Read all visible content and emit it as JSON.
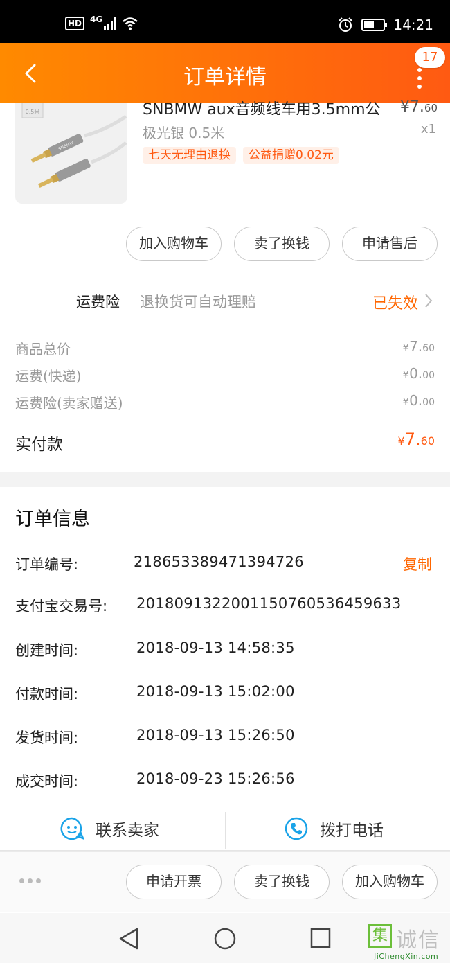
{
  "status_bar": {
    "hd": "HD",
    "network": "4G",
    "time": "14:21",
    "battery_level": 0.55
  },
  "nav": {
    "title": "订单详情",
    "badge_count": "17"
  },
  "product": {
    "name": "SNBMW aux音频线车用3.5mm公",
    "price_symbol": "¥",
    "price_int": "7.",
    "price_dec": "60",
    "spec": "极光银 0.5米",
    "qty": "x1",
    "image_label": "0.5米",
    "image_brand": "SNBMW",
    "tags": [
      "七天无理由退换",
      "公益捐赠0.02元"
    ]
  },
  "item_actions": [
    "加入购物车",
    "卖了换钱",
    "申请售后"
  ],
  "insurance": {
    "label": "运费险",
    "desc": "退换货可自动理赔",
    "status": "已失效"
  },
  "fees": [
    {
      "label": "商品总价",
      "symbol": "¥",
      "int": "7.",
      "dec": "60"
    },
    {
      "label": "运费(快递)",
      "symbol": "¥",
      "int": "0.",
      "dec": "00"
    },
    {
      "label": "运费险(卖家赠送)",
      "symbol": "¥",
      "int": "0.",
      "dec": "00"
    }
  ],
  "total": {
    "label": "实付款",
    "symbol": "¥",
    "int": "7.",
    "dec": "60"
  },
  "order_info": {
    "title": "订单信息",
    "copy_label": "复制",
    "rows": [
      {
        "label": "订单编号:",
        "value": "218653389471394726"
      },
      {
        "label": "支付宝交易号:",
        "value": "2018091322001150760536459633"
      },
      {
        "label": "创建时间:",
        "value": "2018-09-13 14:58:35"
      },
      {
        "label": "付款时间:",
        "value": "2018-09-13 15:02:00"
      },
      {
        "label": "发货时间:",
        "value": "2018-09-13 15:26:50"
      },
      {
        "label": "成交时间:",
        "value": "2018-09-23 15:26:56"
      }
    ]
  },
  "contact": {
    "seller": "联系卖家",
    "phone": "拨打电话"
  },
  "bottom_actions": [
    "申请开票",
    "卖了换钱",
    "加入购物车"
  ],
  "watermark": {
    "box": "集",
    "cn": "诚信",
    "en": "JiChengXin.com"
  },
  "colors": {
    "accent": "#ff5a12",
    "accent_light": "#ff8a00",
    "link_blue": "#1aa3e8"
  }
}
